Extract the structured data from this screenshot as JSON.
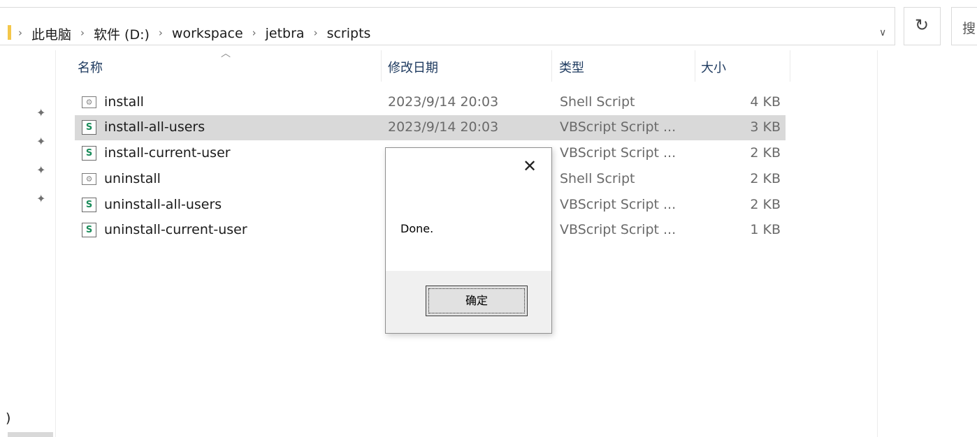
{
  "breadcrumb": {
    "items": [
      "此电脑",
      "软件 (D:)",
      "workspace",
      "jetbra",
      "scripts"
    ]
  },
  "search": {
    "placeholder": "搜"
  },
  "columns": {
    "name": "名称",
    "date": "修改日期",
    "type": "类型",
    "size": "大小"
  },
  "files": [
    {
      "name": "install",
      "date": "2023/9/14 20:03",
      "type": "Shell Script",
      "size": "4 KB",
      "icon": "shell-script-icon"
    },
    {
      "name": "install-all-users",
      "date": "2023/9/14 20:03",
      "type": "VBScript Script ...",
      "size": "3 KB",
      "icon": "vbscript-icon"
    },
    {
      "name": "install-current-user",
      "date": "",
      "type": "VBScript Script ...",
      "size": "2 KB",
      "icon": "vbscript-icon"
    },
    {
      "name": "uninstall",
      "date": "",
      "type": "Shell Script",
      "size": "2 KB",
      "icon": "shell-script-icon"
    },
    {
      "name": "uninstall-all-users",
      "date": "",
      "type": "VBScript Script ...",
      "size": "2 KB",
      "icon": "vbscript-icon"
    },
    {
      "name": "uninstall-current-user",
      "date": "",
      "type": "VBScript Script ...",
      "size": "1 KB",
      "icon": "vbscript-icon"
    }
  ],
  "navpane": {
    "partial_text": ")"
  },
  "dialog": {
    "message": "Done.",
    "ok_label": "确定"
  },
  "colors": {
    "selected_row": "#d9d9d9",
    "dialog_footer": "#f0f0f0",
    "folder": "#f4c74a"
  }
}
